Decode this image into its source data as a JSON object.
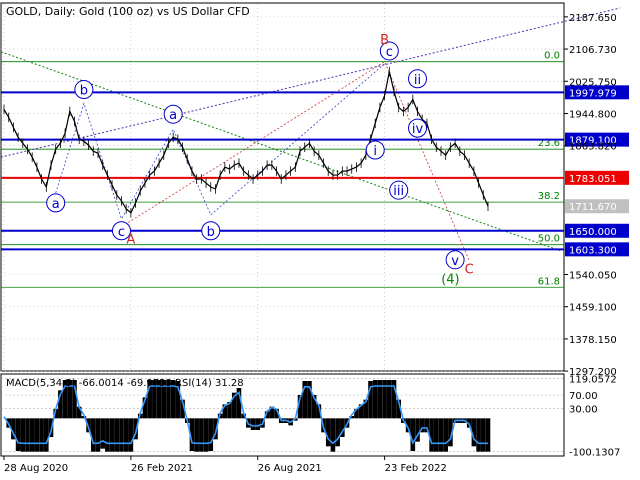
{
  "header": {
    "symbol": "GOLD",
    "timeframe": "Daily",
    "description": "Gold (100 oz) vs US Dollar CFD"
  },
  "chart_data": {
    "type": "line",
    "title": "GOLD, Daily:  Gold (100 oz) vs US Dollar CFD",
    "price_axis": {
      "min": 1297.5,
      "max": 2220,
      "ticks": [
        "2187.650",
        "2106.730",
        "2025.750",
        "1944.800",
        "1863.820",
        "1540.050",
        "1459.100",
        "1378.150",
        "1297.200"
      ]
    },
    "x_axis": {
      "labels": [
        "28 Aug 2020",
        "26 Feb 2021",
        "26 Aug 2021",
        "23 Feb 2022"
      ],
      "label_index": [
        0,
        27,
        54,
        81
      ]
    },
    "close_series": [
      1955,
      1935,
      1910,
      1885,
      1870,
      1855,
      1835,
      1810,
      1780,
      1760,
      1815,
      1855,
      1870,
      1895,
      1950,
      1925,
      1880,
      1875,
      1865,
      1850,
      1845,
      1815,
      1790,
      1765,
      1740,
      1725,
      1705,
      1695,
      1720,
      1750,
      1770,
      1790,
      1800,
      1820,
      1840,
      1870,
      1885,
      1880,
      1860,
      1830,
      1800,
      1780,
      1780,
      1770,
      1760,
      1755,
      1790,
      1810,
      1805,
      1815,
      1820,
      1800,
      1790,
      1780,
      1790,
      1800,
      1815,
      1815,
      1800,
      1780,
      1790,
      1800,
      1810,
      1850,
      1860,
      1870,
      1850,
      1840,
      1820,
      1800,
      1790,
      1790,
      1800,
      1800,
      1805,
      1810,
      1820,
      1840,
      1880,
      1920,
      1960,
      1990,
      2050,
      2000,
      1960,
      1950,
      1960,
      1980,
      1950,
      1930,
      1920,
      1880,
      1860,
      1850,
      1840,
      1860,
      1870,
      1850,
      1840,
      1820,
      1800,
      1770,
      1740,
      1711.67
    ],
    "horizontal_levels": [
      {
        "price": 1997.979,
        "label": "1997.979",
        "color": "#0000cc"
      },
      {
        "price": 1879.1,
        "label": "1879.100",
        "color": "#0000cc"
      },
      {
        "price": 1783.051,
        "label": "1783.051",
        "color": "#ee0000"
      },
      {
        "price": 1650.0,
        "label": "1650.000",
        "color": "#0000cc"
      },
      {
        "price": 1603.3,
        "label": "1603.300",
        "color": "#0000cc"
      }
    ],
    "current_price": {
      "price": 1711.67,
      "label": "1711.670"
    },
    "fibonacci_levels": [
      {
        "price": 2075,
        "label": "0.0"
      },
      {
        "price": 1855,
        "label": "23.6"
      },
      {
        "price": 1722,
        "label": "38.2"
      },
      {
        "price": 1615,
        "label": "50.0"
      },
      {
        "price": 1508,
        "label": "61.8"
      }
    ],
    "wave_labels": [
      {
        "text": "a",
        "index": 11,
        "price": 1720,
        "style": "circle",
        "color": "#0000cc"
      },
      {
        "text": "b",
        "index": 17,
        "price": 2005,
        "style": "circle",
        "color": "#0000cc"
      },
      {
        "text": "c",
        "index": 25,
        "price": 1650,
        "style": "circle",
        "color": "#0000cc"
      },
      {
        "text": "a",
        "index": 36,
        "price": 1943,
        "style": "circle",
        "color": "#0000cc"
      },
      {
        "text": "b",
        "index": 44,
        "price": 1650,
        "style": "circle",
        "color": "#0000cc"
      },
      {
        "text": "c",
        "index": 82,
        "price": 2102,
        "style": "circle",
        "color": "#0000cc"
      },
      {
        "text": "ii",
        "index": 88,
        "price": 2032,
        "style": "circle",
        "color": "#0000cc"
      },
      {
        "text": "i",
        "index": 79,
        "price": 1853,
        "style": "circle",
        "color": "#0000cc"
      },
      {
        "text": "iii",
        "index": 84,
        "price": 1752,
        "style": "circle",
        "color": "#0000cc"
      },
      {
        "text": "iv",
        "index": 88,
        "price": 1908,
        "style": "circle",
        "color": "#0000cc"
      },
      {
        "text": "v",
        "index": 96,
        "price": 1577,
        "style": "circle",
        "color": "#0000cc"
      },
      {
        "text": "B",
        "index": 81,
        "price": 2132,
        "style": "plain",
        "color": "#cc2222"
      },
      {
        "text": "A",
        "index": 27,
        "price": 1630,
        "style": "plain",
        "color": "#cc2222"
      },
      {
        "text": "C",
        "index": 99,
        "price": 1555,
        "style": "plain",
        "color": "#cc2222"
      },
      {
        "text": "(4)",
        "index": 95,
        "price": 1530,
        "style": "plain",
        "color": "#008800"
      }
    ],
    "indicator": {
      "label": "MACD(5,34,5) -66.0014 -69.9753 RSI(14) 31.28",
      "ticks": [
        {
          "value": 119.0572,
          "label": "119.0572"
        },
        {
          "value": 70.0,
          "label": "70.00"
        },
        {
          "value": 30.0,
          "label": "30.00"
        },
        {
          "value": -100.1307,
          "label": "-100.1307"
        }
      ],
      "min": -110,
      "max": 130
    },
    "colors": {
      "price_line": "#000000",
      "grid": "#b0b0b0",
      "fib": "#008000",
      "channel_purple": "#5a2ab0",
      "channel_green": "#108010"
    }
  }
}
